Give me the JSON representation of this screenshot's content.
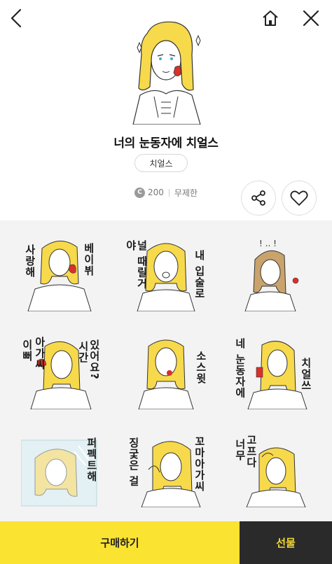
{
  "header": {
    "back_icon": "chevron-left-icon",
    "home_icon": "home-icon",
    "close_icon": "close-icon"
  },
  "product": {
    "title": "너의 눈동자에 치얼스",
    "author": "치얼스",
    "coin_symbol": "C",
    "price": "200",
    "validity": "무제한"
  },
  "actions": {
    "share_icon": "share-icon",
    "like_icon": "heart-icon"
  },
  "stickers": [
    {
      "lines": [
        "사랑해",
        "베이뷔"
      ]
    },
    {
      "lines": [
        "널 때릴거야",
        "내 입술로"
      ]
    },
    {
      "lines": [
        "! .. !"
      ]
    },
    {
      "lines": [
        "이뻐",
        "아가씨",
        "시간",
        "있어요?"
      ]
    },
    {
      "lines": [
        "소스윗"
      ]
    },
    {
      "lines": [
        "네 눈동자에",
        "치얼쓰"
      ]
    },
    {
      "lines": [
        "퍼펙트해"
      ]
    },
    {
      "lines": [
        "징궃은 걸",
        "꼬마아가씨"
      ]
    },
    {
      "lines": [
        "너무",
        "고프다"
      ]
    }
  ],
  "footer": {
    "buy_label": "구매하기",
    "gift_label": "선물"
  },
  "colors": {
    "buy_bg": "#fbe332",
    "gift_bg": "#2a2a2a",
    "gift_text": "#f2d832",
    "hair": "#f7d94c"
  }
}
